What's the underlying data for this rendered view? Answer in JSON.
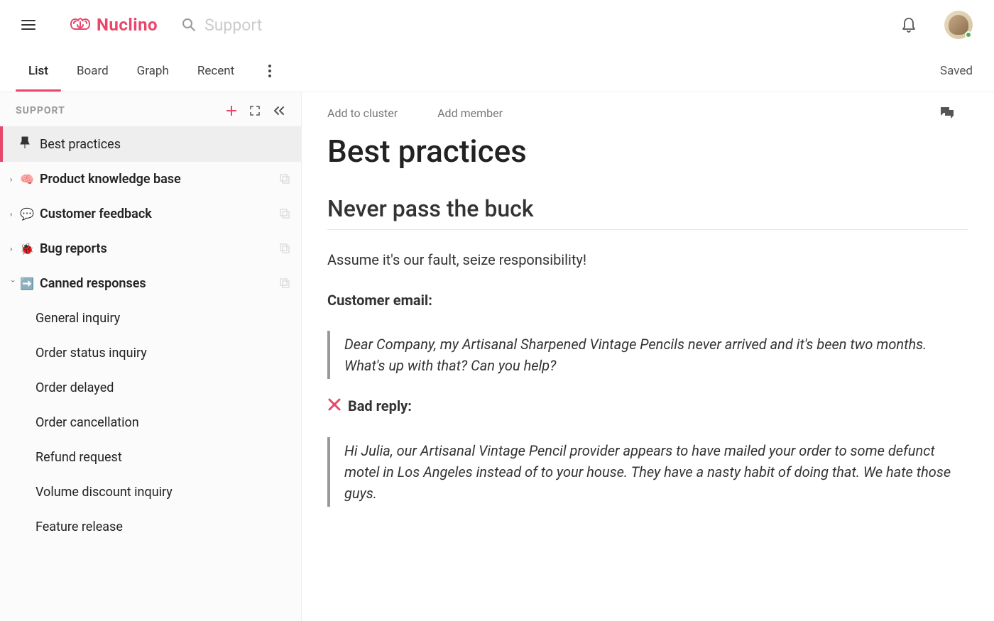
{
  "brand": "Nuclino",
  "search": {
    "placeholder": "Support"
  },
  "tabs": {
    "items": [
      "List",
      "Board",
      "Graph",
      "Recent"
    ],
    "active": 0
  },
  "status": "Saved",
  "sidebar": {
    "title": "SUPPORT",
    "tree": [
      {
        "icon": "📌",
        "label": "Best practices",
        "pinned": true,
        "active": true
      },
      {
        "icon": "🧠",
        "label": "Product knowledge base",
        "children": true,
        "expanded": false
      },
      {
        "icon": "💬",
        "label": "Customer feedback",
        "children": true,
        "expanded": false
      },
      {
        "icon": "🐞",
        "label": "Bug reports",
        "children": true,
        "expanded": false
      },
      {
        "icon": "➡️",
        "label": "Canned responses",
        "children": true,
        "expanded": true,
        "items": [
          "General inquiry",
          "Order status inquiry",
          "Order delayed",
          "Order cancellation",
          "Refund request",
          "Volume discount inquiry",
          "Feature release"
        ]
      }
    ]
  },
  "document": {
    "actions": {
      "cluster": "Add to cluster",
      "member": "Add member"
    },
    "title": "Best practices",
    "h2": "Never pass the buck",
    "intro": "Assume it's our fault, seize responsibility!",
    "label1": "Customer email:",
    "quote1": "Dear Company, my Artisanal Sharpened Vintage Pencils never arrived and it's been two months. What's up with that? Can you help?",
    "label2": "Bad reply:",
    "quote2": "Hi Julia, our Artisanal Vintage Pencil provider appears to have mailed your order to some defunct motel in Los Angeles instead of to your house. They have a nasty habit of doing that. We hate those guys."
  }
}
